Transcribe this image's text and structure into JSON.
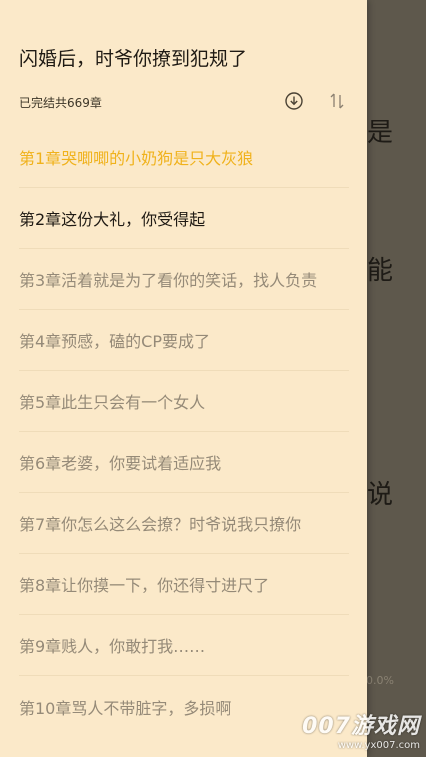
{
  "background_text": {
    "chars": [
      "是",
      "能",
      "说"
    ],
    "small": "0.0%"
  },
  "watermark": {
    "main": "007游戏网",
    "url": "www.yx007.com"
  },
  "drawer": {
    "book_title": "闪婚后，时爷你撩到犯规了",
    "status": "已完结共669章",
    "icons": {
      "download": "download-icon",
      "sort": "sort-icon"
    },
    "colors": {
      "current": "#f0b21c",
      "read": "#1f1a14",
      "unread": "#958a78",
      "background": "#fbe9c9"
    },
    "chapters": [
      {
        "title": "第1章哭唧唧的小奶狗是只大灰狼",
        "state": "current"
      },
      {
        "title": "第2章这份大礼，你受得起",
        "state": "read"
      },
      {
        "title": "第3章活着就是为了看你的笑话，找人负责",
        "state": "unread"
      },
      {
        "title": "第4章预感，磕的CP要成了",
        "state": "unread"
      },
      {
        "title": "第5章此生只会有一个女人",
        "state": "unread"
      },
      {
        "title": "第6章老婆，你要试着适应我",
        "state": "unread"
      },
      {
        "title": "第7章你怎么这么会撩？时爷说我只撩你",
        "state": "unread"
      },
      {
        "title": "第8章让你摸一下，你还得寸进尺了",
        "state": "unread"
      },
      {
        "title": "第9章贱人，你敢打我……",
        "state": "unread"
      },
      {
        "title": "第10章骂人不带脏字，多损啊",
        "state": "unread"
      }
    ]
  }
}
